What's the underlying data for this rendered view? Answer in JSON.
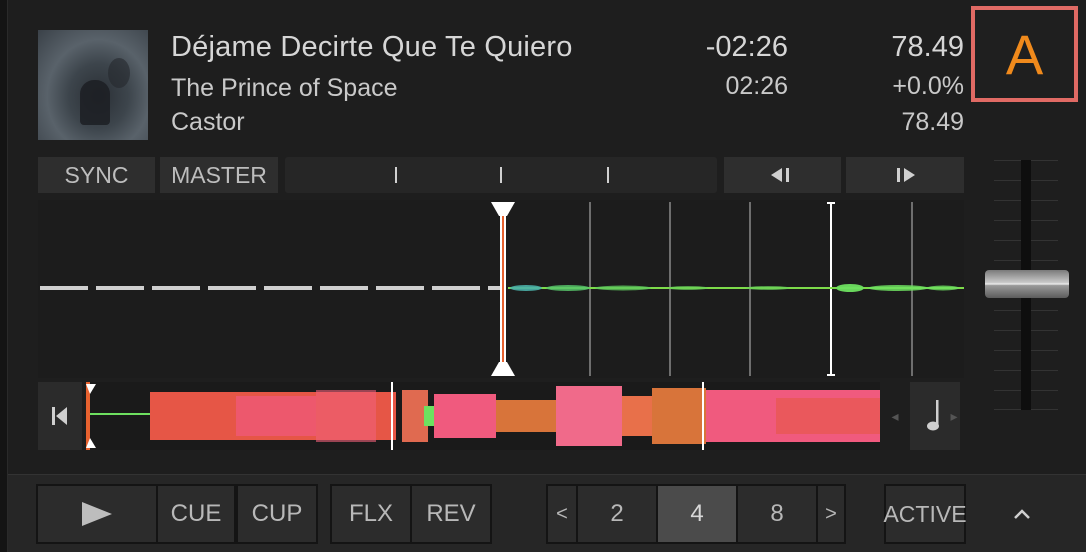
{
  "deck": {
    "letter": "A",
    "accent_color": "#e06a64",
    "letter_color": "#f08a1c"
  },
  "track": {
    "title": "Déjame Decirte Que Te Quiero",
    "artist": "The Prince of Space",
    "album": "Castor",
    "time_remaining": "-02:26",
    "time_elapsed": "02:26",
    "bpm": "78.49",
    "tempo_offset": "+0.0%",
    "original_bpm": "78.49",
    "cover_icon": "album-cover-image"
  },
  "transport": {
    "sync_label": "SYNC",
    "master_label": "MASTER",
    "beatjump_back_icon": "jump-back-icon",
    "beatjump_forward_icon": "jump-forward-icon"
  },
  "waveform": {
    "playhead_color": "#e8622f",
    "played_color": "#cfcfcf",
    "wave_color": "#7ddb4a"
  },
  "overview": {
    "playhead_fraction": 0.0,
    "colors": [
      "#e85640",
      "#f05a7e",
      "#d8743a"
    ],
    "start_icon": "jump-to-start-icon",
    "note_icon": "music-note-icon"
  },
  "tempo_fader": {
    "position_fraction": 0.5
  },
  "bottom": {
    "play_icon": "play-icon",
    "cue_label": "CUE",
    "cup_label": "CUP",
    "flx_label": "FLX",
    "rev_label": "REV",
    "loop_prev": "<",
    "loop_sizes": [
      "2",
      "4",
      "8"
    ],
    "loop_selected": "4",
    "loop_next": ">",
    "active_label": "ACTIVE",
    "collapse_icon": "chevron-up-icon"
  }
}
